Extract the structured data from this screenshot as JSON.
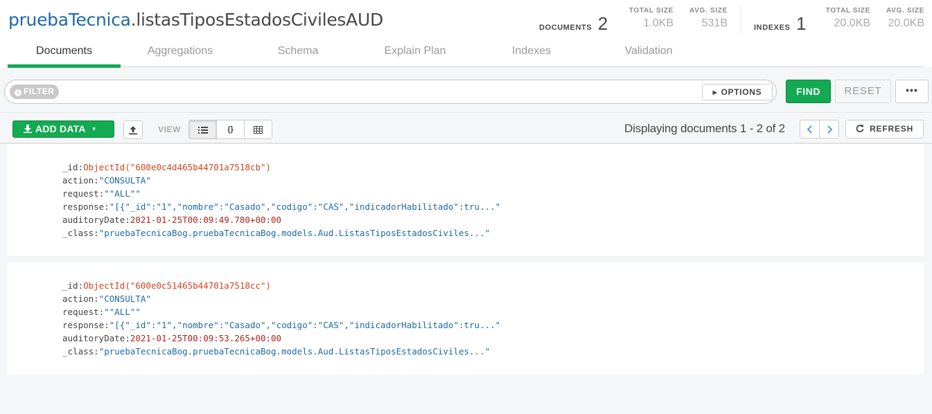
{
  "namespace": {
    "database": "pruebaTecnica",
    "collection": ".listasTiposEstadosCivilesAUD"
  },
  "stats": {
    "documents_label": "DOCUMENTS",
    "documents_count": "2",
    "doc_total_size_label": "TOTAL SIZE",
    "doc_total_size": "1.0KB",
    "doc_avg_size_label": "AVG. SIZE",
    "doc_avg_size": "531B",
    "indexes_label": "INDEXES",
    "indexes_count": "1",
    "idx_total_size_label": "TOTAL SIZE",
    "idx_total_size": "20.0KB",
    "idx_avg_size_label": "AVG. SIZE",
    "idx_avg_size": "20.0KB"
  },
  "tabs": [
    "Documents",
    "Aggregations",
    "Schema",
    "Explain Plan",
    "Indexes",
    "Validation"
  ],
  "active_tab": "Documents",
  "query": {
    "filter_label": "FILTER",
    "options_label": "OPTIONS",
    "find_label": "FIND",
    "reset_label": "RESET",
    "more_label": "•••"
  },
  "toolbar": {
    "add_data_label": "ADD DATA",
    "view_label": "VIEW",
    "view_modes": [
      "list-icon",
      "json-icon",
      "table-icon"
    ],
    "active_view": "list",
    "displaying_text": "Displaying documents 1 - 2 of 2",
    "refresh_label": "REFRESH"
  },
  "documents": [
    {
      "_id": "ObjectId(\"600e0c4d465b44701a7518cb\")",
      "action": "\"CONSULTA\"",
      "request": "\"\"ALL\"\"",
      "response": "\"[{\"_id\":\"1\",\"nombre\":\"Casado\",\"codigo\":\"CAS\",\"indicadorHabilitado\":tru...\"",
      "auditoryDate": "2021-01-25T00:09:49.780+00:00",
      "_class": "\"pruebaTecnicaBog.pruebaTecnicaBog.models.Aud.ListasTiposEstadosCiviles...\""
    },
    {
      "_id": "ObjectId(\"600e0c51465b44701a7518cc\")",
      "action": "\"CONSULTA\"",
      "request": "\"\"ALL\"\"",
      "response": "\"[{\"_id\":\"1\",\"nombre\":\"Casado\",\"codigo\":\"CAS\",\"indicadorHabilitado\":tru...\"",
      "auditoryDate": "2021-01-25T00:09:53.265+00:00",
      "_class": "\"pruebaTecnicaBog.pruebaTecnicaBog.models.Aud.ListasTiposEstadosCiviles...\""
    }
  ],
  "field_keys": {
    "_id": "_id",
    "action": "action",
    "request": "request",
    "response": "response",
    "auditoryDate": "auditoryDate",
    "_class": "_class"
  },
  "colors": {
    "accent_green": "#13aa52",
    "namespace_blue": "#1e6aa8",
    "string_value": "#1e6aa8",
    "objectid_value": "#d4431f",
    "date_value": "#b0241c"
  }
}
